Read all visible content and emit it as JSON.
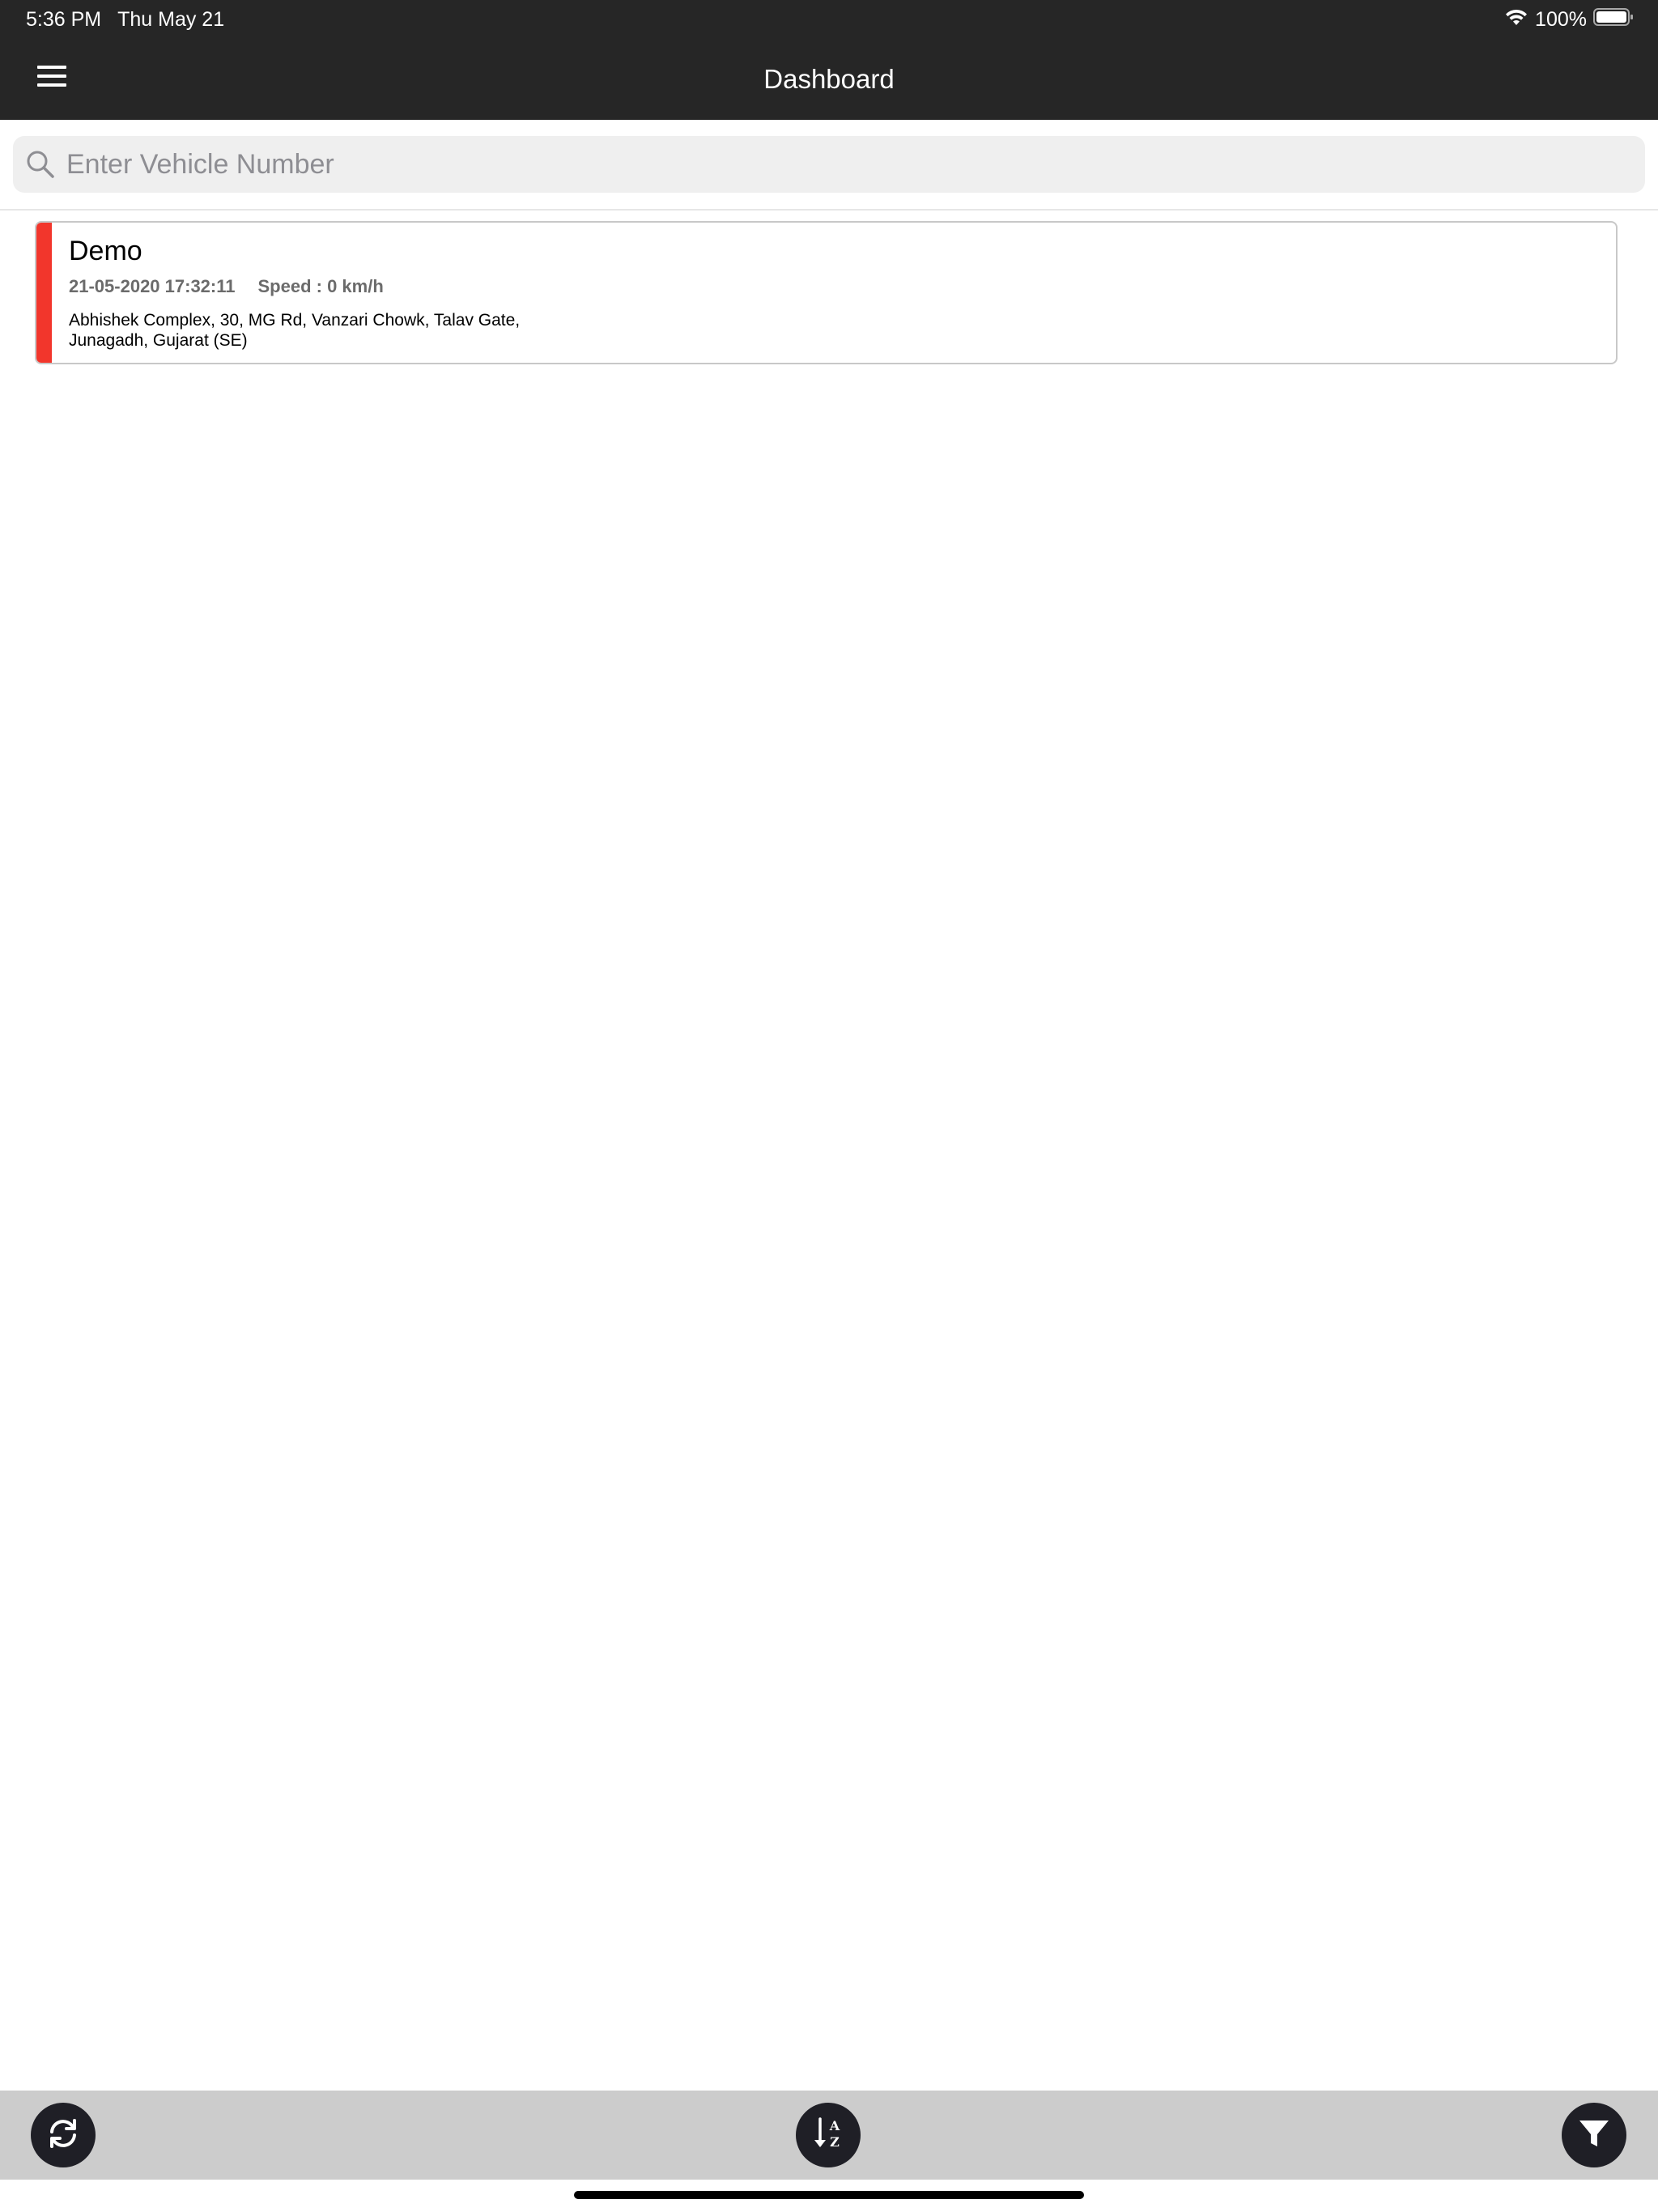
{
  "status_bar": {
    "time": "5:36 PM",
    "date": "Thu May 21",
    "battery": "100%",
    "wifi_icon": "wifi-icon",
    "battery_icon": "battery-full-icon"
  },
  "nav": {
    "title": "Dashboard",
    "menu_icon": "hamburger-menu-icon"
  },
  "search": {
    "placeholder": "Enter Vehicle Number",
    "value": "",
    "icon": "search-icon"
  },
  "vehicles": [
    {
      "name": "Demo",
      "timestamp": "21-05-2020 17:32:11",
      "speed": "Speed : 0 km/h",
      "address": "Abhishek Complex, 30, MG Rd, Vanzari Chowk, Talav Gate, Junagadh, Gujarat (SE)",
      "status_color": "#f2362c"
    }
  ],
  "toolbar": {
    "refresh_icon": "refresh-icon",
    "sort_icon": "sort-a-z-icon",
    "filter_icon": "filter-icon",
    "button_color": "#1f1f26",
    "bar_color": "#cccccc"
  },
  "colors": {
    "header_bg": "#262626",
    "search_bg": "#efefef"
  }
}
